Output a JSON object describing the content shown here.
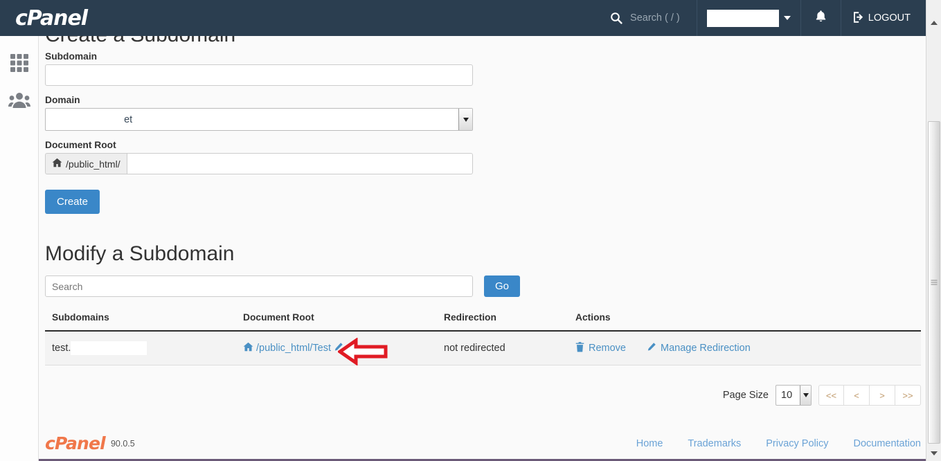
{
  "header": {
    "brand": "cPanel",
    "search_placeholder": "Search ( / )",
    "search_icon": "search-icon",
    "account_name": "",
    "notifications_icon": "bell-icon",
    "logout_label": "LOGOUT",
    "logout_icon": "logout-icon"
  },
  "sidebar": {
    "items": [
      {
        "name": "tools-grid",
        "icon": "grid-icon"
      },
      {
        "name": "user-manager",
        "icon": "users-icon"
      }
    ]
  },
  "create_section": {
    "heading": "Create a Subdomain",
    "subdomain_label": "Subdomain",
    "subdomain_value": "",
    "domain_label": "Domain",
    "domain_selected": ".net",
    "docroot_label": "Document Root",
    "docroot_prefix": "/public_html/",
    "docroot_prefix_icon": "home-icon",
    "docroot_value": "",
    "create_button": "Create"
  },
  "modify_section": {
    "heading": "Modify a Subdomain",
    "search_placeholder": "Search",
    "search_value": "",
    "go_button": "Go"
  },
  "table": {
    "columns": [
      "Subdomains",
      "Document Root",
      "Redirection",
      "Actions"
    ],
    "rows": [
      {
        "subdomain": "test.",
        "document_root": "/public_html/Test",
        "document_root_icon": "home-icon",
        "document_root_edit_icon": "pencil-icon",
        "redirection": "not redirected",
        "actions": [
          {
            "label": "Remove",
            "icon": "trash-icon"
          },
          {
            "label": "Manage Redirection",
            "icon": "pencil-icon"
          }
        ]
      }
    ]
  },
  "annotation": {
    "type": "left-arrow",
    "color": "#e01b24"
  },
  "pagination": {
    "page_size_label": "Page Size",
    "page_size_value": "10",
    "buttons": [
      "<<",
      "<",
      ">",
      ">>"
    ]
  },
  "footer": {
    "brand": "cPanel",
    "version": "90.0.5",
    "links": [
      "Home",
      "Trademarks",
      "Privacy Policy",
      "Documentation"
    ]
  },
  "colors": {
    "header_bg": "#2b3e50",
    "primary": "#3a87c8",
    "link": "#4a90c4",
    "brand_orange": "#f0774a"
  }
}
